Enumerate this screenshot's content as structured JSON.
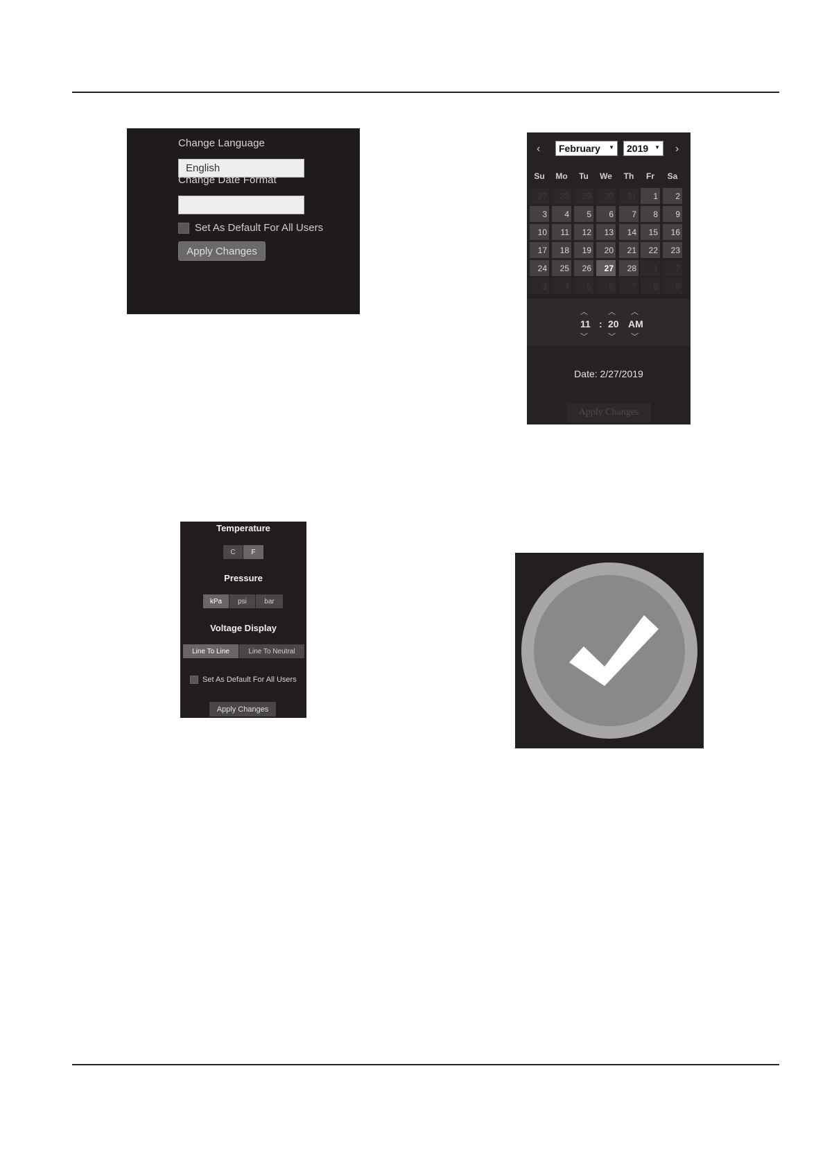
{
  "language_panel": {
    "language_label": "Change Language",
    "language_value": "English",
    "date_format_label": "Change Date Format",
    "date_format_value": "",
    "default_label": "Set As Default For All Users",
    "apply_label": "Apply Changes"
  },
  "calendar_panel": {
    "prev_arrow": "‹",
    "next_arrow": "›",
    "month": "February",
    "year": "2019",
    "weekdays": [
      "Su",
      "Mo",
      "Tu",
      "We",
      "Th",
      "Fr",
      "Sa"
    ],
    "weeks": [
      [
        "27",
        "28",
        "29",
        "30",
        "31",
        "1",
        "2"
      ],
      [
        "3",
        "4",
        "5",
        "6",
        "7",
        "8",
        "9"
      ],
      [
        "10",
        "11",
        "12",
        "13",
        "14",
        "15",
        "16"
      ],
      [
        "17",
        "18",
        "19",
        "20",
        "21",
        "22",
        "23"
      ],
      [
        "24",
        "25",
        "26",
        "27",
        "28",
        "1",
        "2"
      ],
      [
        "3",
        "4",
        "5",
        "6",
        "7",
        "8",
        "9"
      ]
    ],
    "selected_day": "27",
    "time_hour": "11",
    "time_separator": ":",
    "time_minute": "20",
    "time_period": "AM",
    "date_text": "Date: 2/27/2019",
    "apply_label": "Apply Changes"
  },
  "units_panel": {
    "temperature_title": "Temperature",
    "temperature_options": [
      "C",
      "F"
    ],
    "pressure_title": "Pressure",
    "pressure_options": [
      "kPa",
      "psi",
      "bar"
    ],
    "voltage_title": "Voltage Display",
    "voltage_options": [
      "Line To Line",
      "Line To Neutral"
    ],
    "default_label": "Set As Default For All Users",
    "apply_label": "Apply Changes"
  },
  "colors": {
    "panel_bg": "#1f1a1b",
    "outer_ring": "#a7a5a6",
    "inner_disc": "#8a8889",
    "check_mark": "#ffffff"
  },
  "icons": {
    "confirmation": "check-circle-icon",
    "dropdown": "caret-down-icon",
    "time_up": "chevron-up-icon",
    "time_down": "chevron-down-icon"
  }
}
